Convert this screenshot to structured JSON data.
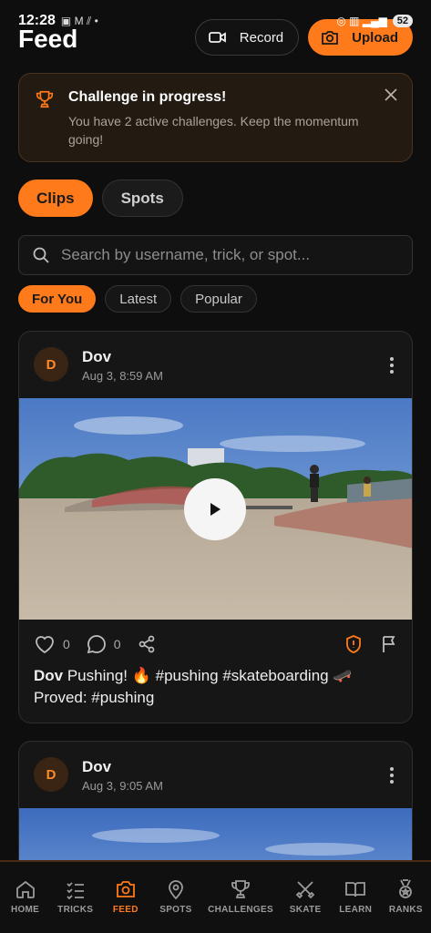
{
  "status_bar": {
    "time": "12:28",
    "left_icons": "▣ M ⫽ •",
    "battery": "52"
  },
  "header": {
    "title": "Feed",
    "record_label": "Record",
    "upload_label": "Upload"
  },
  "challenge": {
    "title": "Challenge in progress!",
    "description": "You have 2 active challenges. Keep the momentum going!"
  },
  "content_tabs": [
    {
      "label": "Clips",
      "active": true
    },
    {
      "label": "Spots",
      "active": false
    }
  ],
  "search": {
    "placeholder": "Search by username, trick, or spot..."
  },
  "filters": [
    {
      "label": "For You",
      "active": true
    },
    {
      "label": "Latest",
      "active": false
    },
    {
      "label": "Popular",
      "active": false
    }
  ],
  "posts": [
    {
      "avatar_initial": "D",
      "username": "Dov",
      "timestamp": "Aug 3, 8:59 AM",
      "likes": "0",
      "comments": "0",
      "caption_user": "Dov",
      "caption_text": " Pushing! 🔥 #pushing #skateboarding 🛹 Proved: #pushing"
    },
    {
      "avatar_initial": "D",
      "username": "Dov",
      "timestamp": "Aug 3, 9:05 AM"
    }
  ],
  "bottom_nav": [
    {
      "label": "HOME",
      "icon": "home-icon"
    },
    {
      "label": "TRICKS",
      "icon": "checklist-icon"
    },
    {
      "label": "FEED",
      "icon": "camera-icon",
      "active": true
    },
    {
      "label": "SPOTS",
      "icon": "map-pin-icon"
    },
    {
      "label": "CHALLENGES",
      "icon": "trophy-icon"
    },
    {
      "label": "SKATE",
      "icon": "crossed-swords-icon"
    },
    {
      "label": "LEARN",
      "icon": "book-icon"
    },
    {
      "label": "RANKS",
      "icon": "medal-icon"
    }
  ],
  "colors": {
    "accent": "#ff7a1a",
    "background": "#0e0e0e",
    "card": "#161616"
  }
}
